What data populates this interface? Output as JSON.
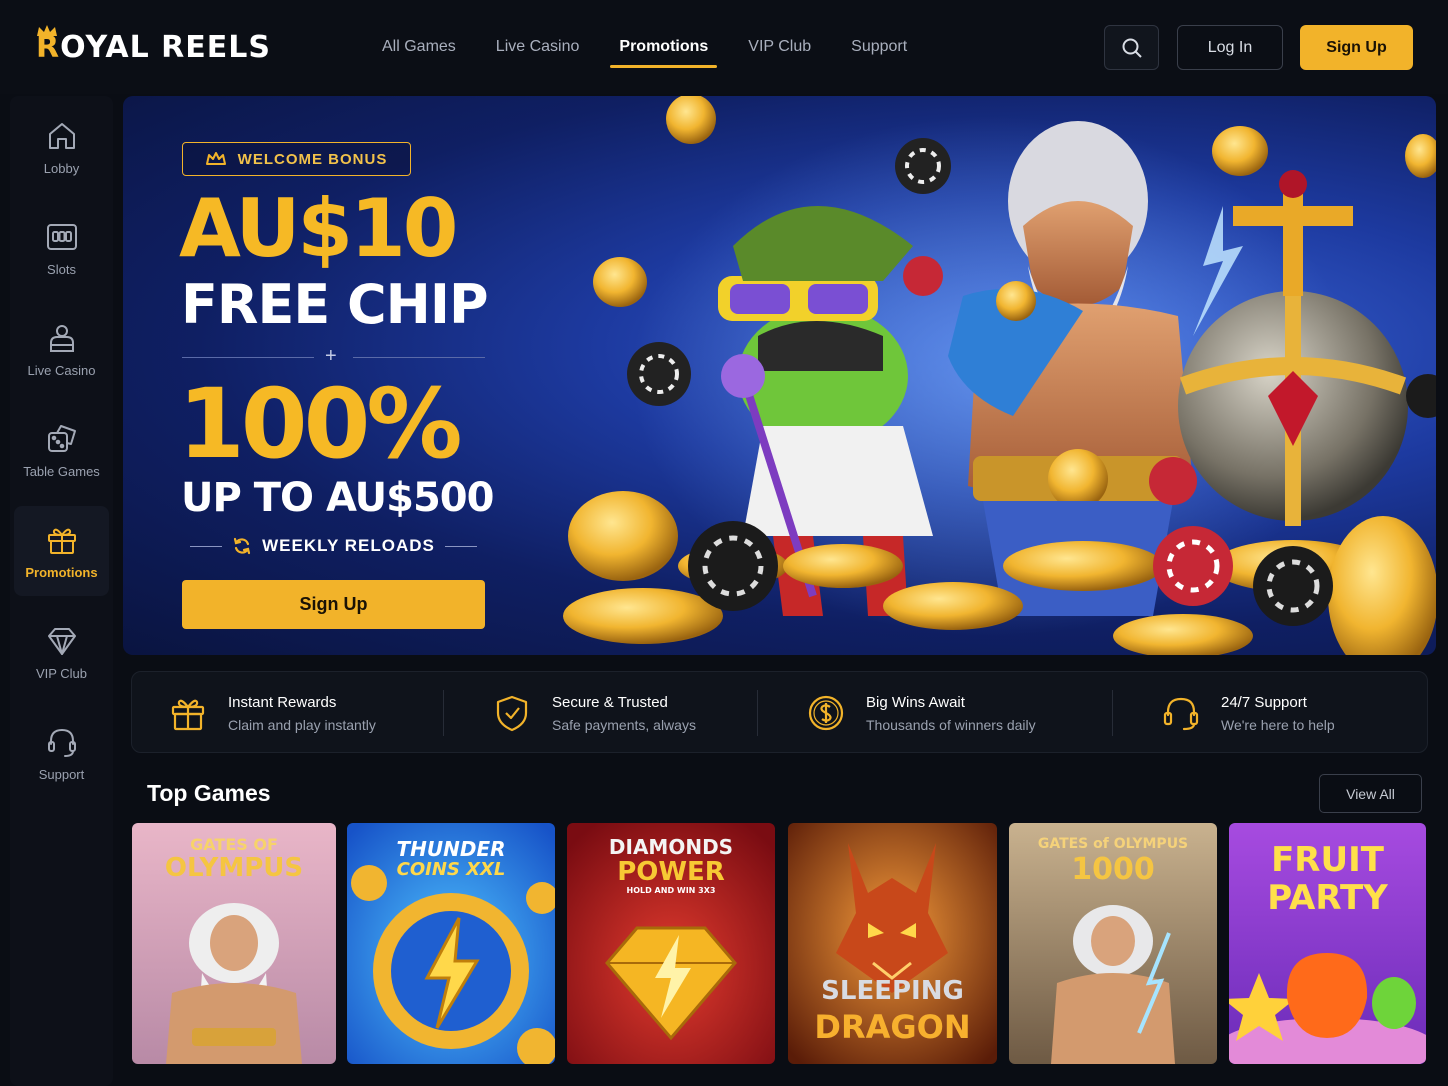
{
  "brand": {
    "name_first": "R",
    "name_rest": "OYAL REELS"
  },
  "nav": {
    "items": [
      "All Games",
      "Live Casino",
      "Promotions",
      "VIP Club",
      "Support"
    ],
    "active": "Promotions"
  },
  "header": {
    "login_label": "Log In",
    "signup_label": "Sign Up",
    "search_icon": "search-icon"
  },
  "sidebar": {
    "items": [
      {
        "label": "Lobby",
        "icon": "home-icon"
      },
      {
        "label": "Slots",
        "icon": "slot-machine-icon"
      },
      {
        "label": "Live Casino",
        "icon": "live-dealer-icon"
      },
      {
        "label": "Table Games",
        "icon": "dice-icon"
      },
      {
        "label": "Promotions",
        "icon": "gift-icon"
      },
      {
        "label": "VIP Club",
        "icon": "diamond-icon"
      },
      {
        "label": "Support",
        "icon": "headset-icon"
      }
    ],
    "active": "Promotions"
  },
  "hero": {
    "badge": "WELCOME BONUS",
    "amount": "AU$10",
    "subtitle": "FREE CHIP",
    "plus": "+",
    "percent": "100%",
    "upto": "UP TO AU$500",
    "weekly": "WEEKLY RELOADS",
    "cta": "Sign Up"
  },
  "features": [
    {
      "title": "Instant Rewards",
      "subtitle": "Claim and play instantly",
      "icon": "gift-icon"
    },
    {
      "title": "Secure & Trusted",
      "subtitle": "Safe payments, always",
      "icon": "shield-check-icon"
    },
    {
      "title": "Big Wins Await",
      "subtitle": "Thousands of winners daily",
      "icon": "dollar-coin-icon"
    },
    {
      "title": "24/7 Support",
      "subtitle": "We're here to help",
      "icon": "headset-icon"
    }
  ],
  "top_games": {
    "title": "Top Games",
    "view_all": "View All",
    "games": [
      {
        "title_line1": "GATES OF",
        "title_line2": "OLYMPUS"
      },
      {
        "title_line1": "THUNDER",
        "title_line2": "COINS XXL"
      },
      {
        "title_line1": "DIAMONDS",
        "title_line2": "POWER",
        "tagline": "HOLD AND WIN 3X3"
      },
      {
        "title_line1": "SLEEPING",
        "title_line2": "DRAGON"
      },
      {
        "title_line1": "GATES of OLYMPUS",
        "title_line2": "1000"
      },
      {
        "title_line1": "FRUIT",
        "title_line2": "PARTY"
      }
    ]
  },
  "colors": {
    "accent": "#f2b32a",
    "background": "#0a0d14",
    "hero_blue": "#1d3aa0"
  }
}
